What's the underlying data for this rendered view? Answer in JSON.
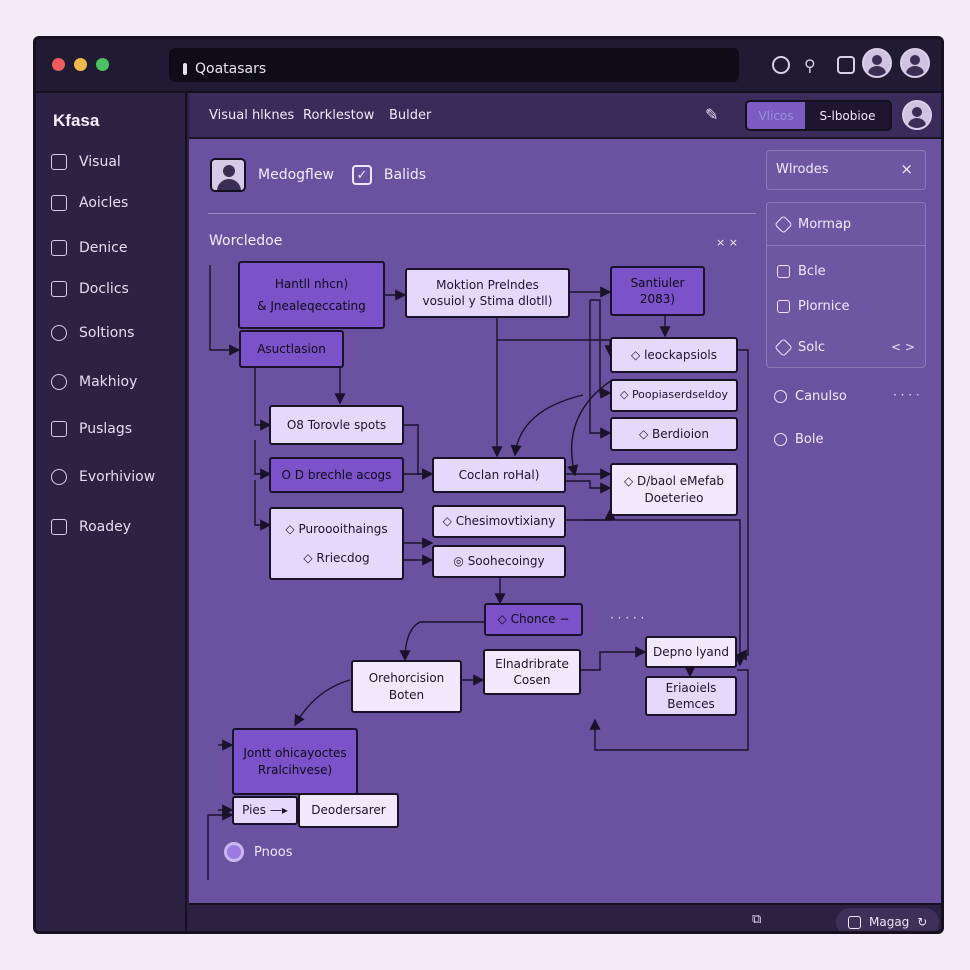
{
  "window": {
    "address": "Qoatasars"
  },
  "sidebar": {
    "brand": "Kfasa",
    "items": [
      {
        "label": "Visual"
      },
      {
        "label": "Aoicles"
      },
      {
        "label": "Denice"
      },
      {
        "label": "Doclics"
      },
      {
        "label": "Soltions"
      },
      {
        "label": "Makhioy"
      },
      {
        "label": "Puslags"
      },
      {
        "label": "Evorhiviow"
      },
      {
        "label": "Roadey"
      }
    ]
  },
  "topnav": {
    "crumbs": [
      "Visual hlknes",
      "Rorklestow",
      "Bulder"
    ],
    "toggle_on": "Vlicos",
    "toggle_off": "S-lbobioe"
  },
  "canvas": {
    "header_title": "Medogflew",
    "header_check": "Balids",
    "section_title": "Worcledoe",
    "section_close": "× ×",
    "nodes": {
      "n1a": "Hantll nhcn)",
      "n1b": "& Jnealeqeccating",
      "n2": "Asuctlasion",
      "n3a": "Moktion Prelndes",
      "n3b": "vosuiol y Stima dlotll)",
      "n4a": "Santiuler",
      "n4b": "2083)",
      "n5": "◇ leockapsiols",
      "n6": "◇ Poopiaserdseldoy",
      "n7": "◇ Berdioion",
      "n8a": "◇ D/baol eMefab",
      "n8b": "Doeterieo",
      "n9": "O8 Torovle spots",
      "n10": "O D brechle acogs",
      "n11": "Coclan roHal)",
      "n12a": "◇ Puroooithaings",
      "n12b": "◇ Rriecdog",
      "n13": "◇ Chesimovtixiany",
      "n14": "◎ Soohecoingy",
      "n15": "◇ Chonce  −",
      "n16a": "Orehorcision",
      "n16b": "Boten",
      "n17a": "Elnadribrate",
      "n17b": "Cosen",
      "n18": "Depno lyand",
      "n19a": "Eriaoiels",
      "n19b": "Bemces",
      "n20a": "Jontt ohicayoctes",
      "n20b": "Rralcihvese)",
      "n21": "Pies —▸",
      "n22": "Deodersarer",
      "ellipsis": "· · · · ·",
      "footer_label": "Pnoos"
    }
  },
  "panel": {
    "title": "Wlrodes",
    "close": "×",
    "items": [
      {
        "label": "Mormap"
      },
      {
        "label": "Bcle"
      },
      {
        "label": "Plornice"
      },
      {
        "label": "Solc"
      },
      {
        "label": "Canulso"
      },
      {
        "label": "Bole"
      }
    ],
    "solc_arrows": "< >",
    "canulso_more": "· · · ·"
  },
  "statusbar": {
    "pill_label": "Magag"
  },
  "colors": {
    "canvas": "#6a52a0",
    "node_dark": "#7b52c8",
    "node_light": "#e6d8fb",
    "sidebar": "#2c2242"
  }
}
